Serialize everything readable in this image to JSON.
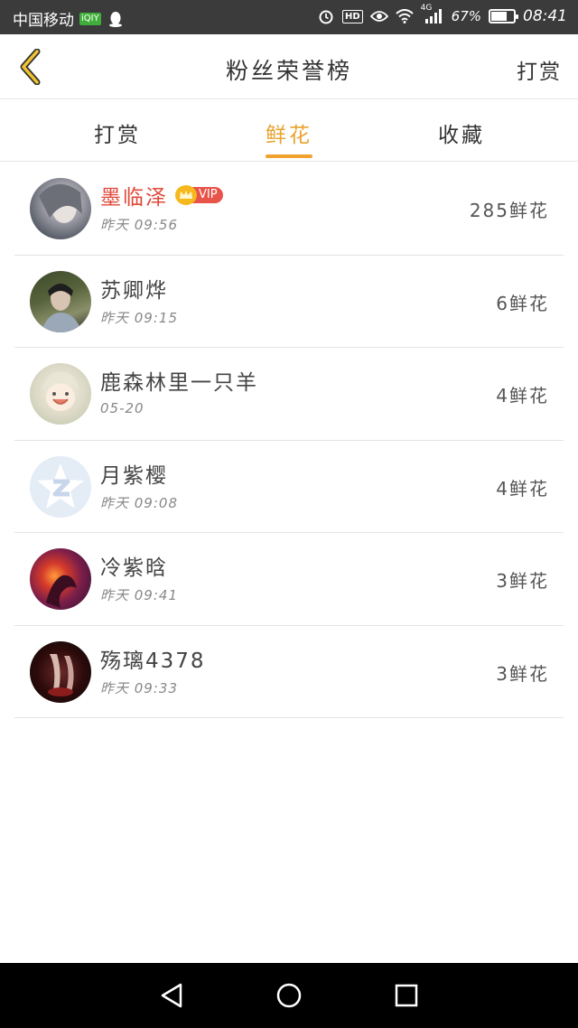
{
  "status_bar": {
    "carrier": "中国移动",
    "badge": "iQIY",
    "hd": "HD",
    "network": "4G",
    "battery_text": "67%",
    "battery_level": 0.67,
    "time": "08:41"
  },
  "header": {
    "title": "粉丝荣誉榜",
    "action_label": "打赏",
    "accent_color": "#e8a32f"
  },
  "tabs": [
    {
      "label": "打赏",
      "active": false
    },
    {
      "label": "鲜花",
      "active": true
    },
    {
      "label": "收藏",
      "active": false
    }
  ],
  "vip_label": "VIP",
  "fans": [
    {
      "name": "墨临泽",
      "time": "昨天 09:56",
      "count": "285鲜花",
      "vip": true,
      "avatar": "avatar-portrait-pale"
    },
    {
      "name": "苏卿烨",
      "time": "昨天 09:15",
      "count": "6鲜花",
      "vip": false,
      "avatar": "avatar-portrait-green"
    },
    {
      "name": "鹿森林里一只羊",
      "time": "05-20",
      "count": "4鲜花",
      "vip": false,
      "avatar": "avatar-anime-light"
    },
    {
      "name": "月紫樱",
      "time": "昨天 09:08",
      "count": "4鲜花",
      "vip": false,
      "avatar": "avatar-qq-default"
    },
    {
      "name": "冷紫晗",
      "time": "昨天 09:41",
      "count": "3鲜花",
      "vip": false,
      "avatar": "avatar-fire-purple"
    },
    {
      "name": "殇璃4378",
      "time": "昨天 09:33",
      "count": "3鲜花",
      "vip": false,
      "avatar": "avatar-dark-red"
    }
  ],
  "nav": {
    "back_icon": "triangle-back-icon",
    "home_icon": "circle-home-icon",
    "recents_icon": "square-recents-icon"
  }
}
